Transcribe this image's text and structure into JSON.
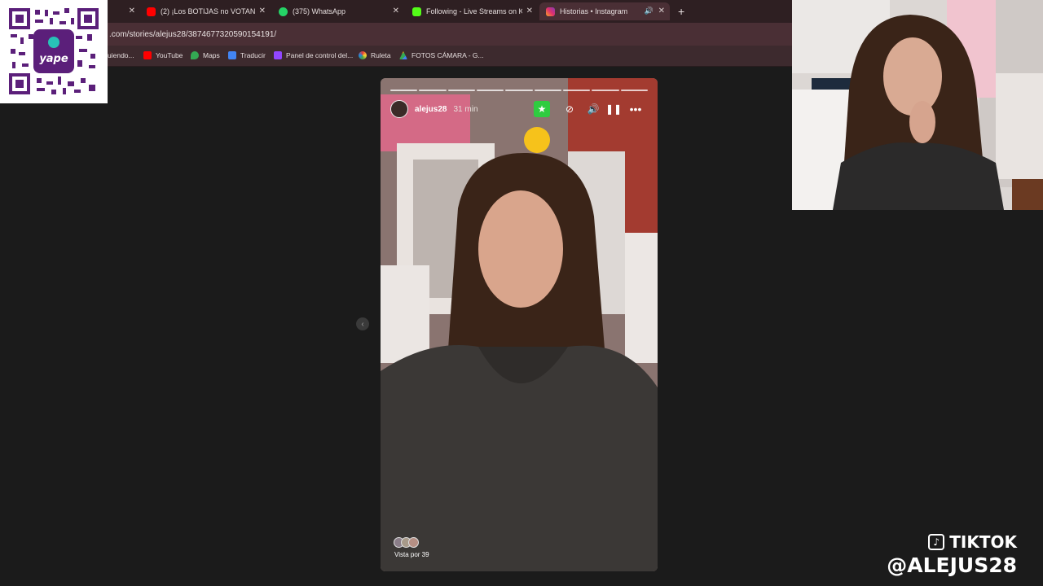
{
  "tabs": [
    {
      "label": "",
      "icon": "tab-icon"
    },
    {
      "label": "(2) ¡Los BOTIJAS no VOTAN",
      "icon": "youtube-icon",
      "color": "#ff0000"
    },
    {
      "label": "(375) WhatsApp",
      "icon": "whatsapp-icon",
      "color": "#25d366"
    },
    {
      "label": "Following - Live Streams on Kic",
      "icon": "kick-icon",
      "color": "#53fc18"
    },
    {
      "label": "Historias • Instagram",
      "icon": "instagram-icon",
      "color": "#e1306c"
    }
  ],
  "address": {
    "url": ".com/stories/alejus28/3874677320590154191/"
  },
  "bookmarks": [
    {
      "label": "uiendo...",
      "icon": "bookmark-icon"
    },
    {
      "label": "YouTube",
      "icon": "youtube-icon"
    },
    {
      "label": "Maps",
      "icon": "maps-icon"
    },
    {
      "label": "Traducir",
      "icon": "translate-icon"
    },
    {
      "label": "Panel de control del...",
      "icon": "dashboard-icon"
    },
    {
      "label": "Ruleta",
      "icon": "wheel-icon"
    },
    {
      "label": "FOTOS CÁMARA - G...",
      "icon": "drive-icon"
    }
  ],
  "story": {
    "username": "alejus28",
    "time": "31 min",
    "seen_by": "Vista por 39",
    "segments": 9
  },
  "qr": {
    "brand": "yape"
  },
  "overlay": {
    "line1": "TIKTOK",
    "line2": "@ALEJUS28"
  }
}
